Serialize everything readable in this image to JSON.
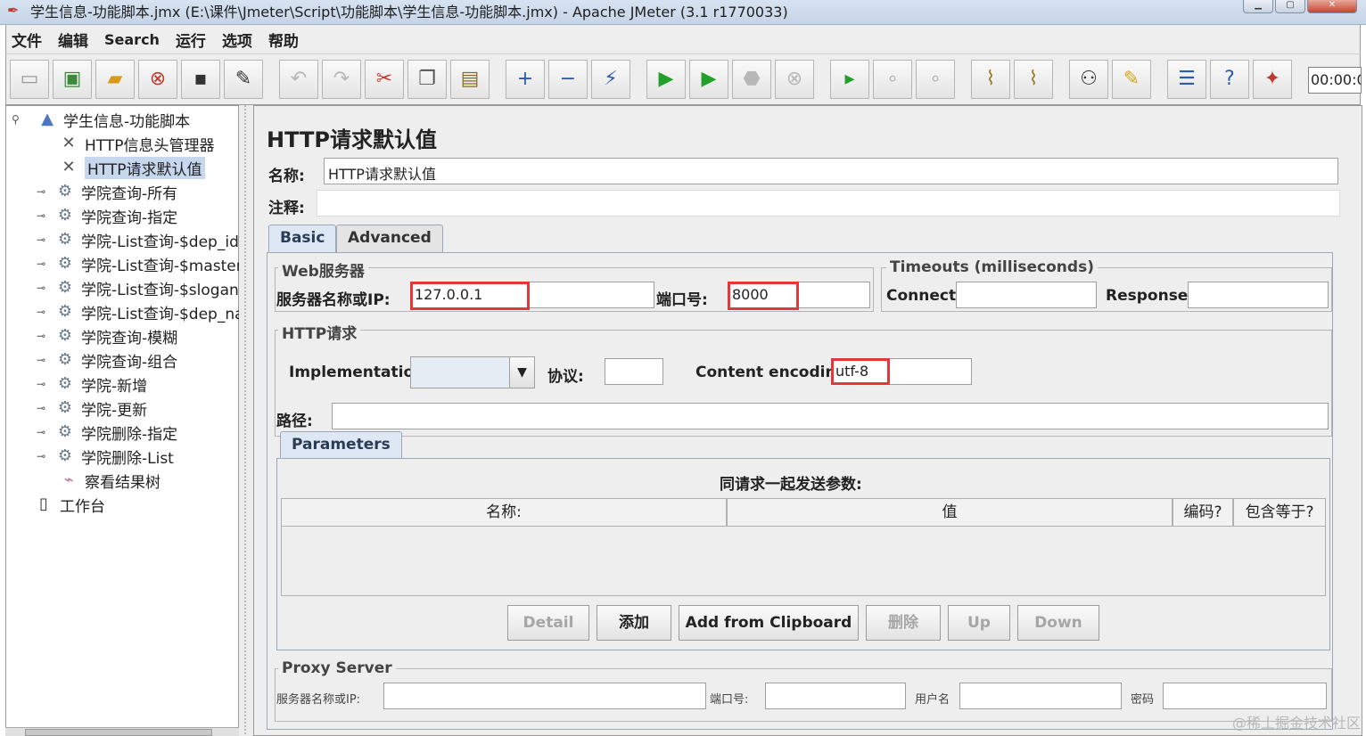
{
  "window": {
    "title": "学生信息-功能脚本.jmx (E:\\课件\\Jmeter\\Script\\功能脚本\\学生信息-功能脚本.jmx) - Apache JMeter (3.1 r1770033)"
  },
  "menu": [
    "文件",
    "编辑",
    "Search",
    "运行",
    "选项",
    "帮助"
  ],
  "toolbar": {
    "timer": "00:00:0",
    "icons": [
      "new-icon",
      "templates-icon",
      "open-icon",
      "close-icon",
      "save-icon",
      "save-as-icon",
      "undo-icon",
      "redo-icon",
      "cut-icon",
      "copy-icon",
      "paste-icon",
      "expand-icon",
      "collapse-icon",
      "toggle-icon",
      "start-icon",
      "start-no-timers-icon",
      "stop-icon",
      "shutdown-icon",
      "remote-start-icon",
      "remote-stop-icon",
      "remote-shutdown-icon",
      "clear-icon",
      "clear-all-icon",
      "search-icon",
      "reset-search-icon",
      "function-helper-icon",
      "help-icon",
      "log-viewer-icon"
    ]
  },
  "tree": {
    "root": "学生信息-功能脚本",
    "items": [
      "HTTP信息头管理器",
      "HTTP请求默认值",
      "学院查询-所有",
      "学院查询-指定",
      "学院-List查询-$dep_id",
      "学院-List查询-$master",
      "学院-List查询-$slogan",
      "学院-List查询-$dep_na",
      "学院查询-模糊",
      "学院查询-组合",
      "学院-新增",
      "学院-更新",
      "学院删除-指定",
      "学院删除-List",
      "察看结果树"
    ],
    "workbench": "工作台"
  },
  "main": {
    "title": "HTTP请求默认值",
    "name_label": "名称:",
    "name_value": "HTTP请求默认值",
    "comment_label": "注释:",
    "tabs": [
      "Basic",
      "Advanced"
    ],
    "web_server": {
      "group": "Web服务器",
      "server_label": "服务器名称或IP:",
      "server_value": "127.0.0.1",
      "port_label": "端口号:",
      "port_value": "8000"
    },
    "timeouts": {
      "group": "Timeouts (milliseconds)",
      "connect_label": "Connect:",
      "response_label": "Response:"
    },
    "http_request": {
      "group": "HTTP请求",
      "implementation_label": "Implementation:",
      "protocol_label": "协议:",
      "encoding_label": "Content encoding:",
      "encoding_value": "utf-8",
      "path_label": "路径:"
    },
    "parameters": {
      "tab": "Parameters",
      "caption": "同请求一起发送参数:",
      "columns": [
        "名称:",
        "值",
        "编码?",
        "包含等于?"
      ],
      "buttons": [
        "Detail",
        "添加",
        "Add from Clipboard",
        "删除",
        "Up",
        "Down"
      ]
    },
    "proxy": {
      "group": "Proxy Server",
      "server_label": "服务器名称或IP:",
      "port_label": "端口号:",
      "user_label": "用户名",
      "password_label": "密码"
    }
  },
  "watermark": "@稀土掘金技术社区"
}
